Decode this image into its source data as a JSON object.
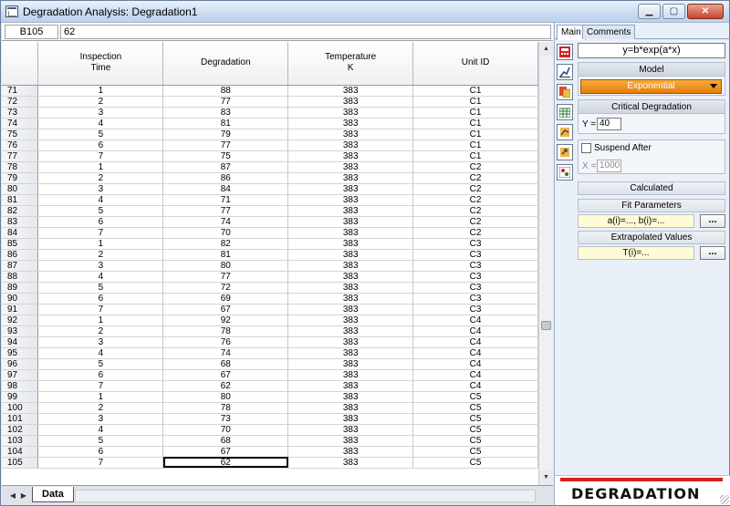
{
  "window": {
    "title": "Degradation Analysis: Degradation1"
  },
  "formula_bar": {
    "cell_ref": "B105",
    "cell_value": "62"
  },
  "grid": {
    "headers": [
      "",
      "Inspection\nTime",
      "Degradation",
      "Temperature\nK",
      "Unit ID"
    ],
    "rows": [
      [
        "71",
        "1",
        "88",
        "383",
        "C1"
      ],
      [
        "72",
        "2",
        "77",
        "383",
        "C1"
      ],
      [
        "73",
        "3",
        "83",
        "383",
        "C1"
      ],
      [
        "74",
        "4",
        "81",
        "383",
        "C1"
      ],
      [
        "75",
        "5",
        "79",
        "383",
        "C1"
      ],
      [
        "76",
        "6",
        "77",
        "383",
        "C1"
      ],
      [
        "77",
        "7",
        "75",
        "383",
        "C1"
      ],
      [
        "78",
        "1",
        "87",
        "383",
        "C2"
      ],
      [
        "79",
        "2",
        "86",
        "383",
        "C2"
      ],
      [
        "80",
        "3",
        "84",
        "383",
        "C2"
      ],
      [
        "81",
        "4",
        "71",
        "383",
        "C2"
      ],
      [
        "82",
        "5",
        "77",
        "383",
        "C2"
      ],
      [
        "83",
        "6",
        "74",
        "383",
        "C2"
      ],
      [
        "84",
        "7",
        "70",
        "383",
        "C2"
      ],
      [
        "85",
        "1",
        "82",
        "383",
        "C3"
      ],
      [
        "86",
        "2",
        "81",
        "383",
        "C3"
      ],
      [
        "87",
        "3",
        "80",
        "383",
        "C3"
      ],
      [
        "88",
        "4",
        "77",
        "383",
        "C3"
      ],
      [
        "89",
        "5",
        "72",
        "383",
        "C3"
      ],
      [
        "90",
        "6",
        "69",
        "383",
        "C3"
      ],
      [
        "91",
        "7",
        "67",
        "383",
        "C3"
      ],
      [
        "92",
        "1",
        "92",
        "383",
        "C4"
      ],
      [
        "93",
        "2",
        "78",
        "383",
        "C4"
      ],
      [
        "94",
        "3",
        "76",
        "383",
        "C4"
      ],
      [
        "95",
        "4",
        "74",
        "383",
        "C4"
      ],
      [
        "96",
        "5",
        "68",
        "383",
        "C4"
      ],
      [
        "97",
        "6",
        "67",
        "383",
        "C4"
      ],
      [
        "98",
        "7",
        "62",
        "383",
        "C4"
      ],
      [
        "99",
        "1",
        "80",
        "383",
        "C5"
      ],
      [
        "100",
        "2",
        "78",
        "383",
        "C5"
      ],
      [
        "101",
        "3",
        "73",
        "383",
        "C5"
      ],
      [
        "102",
        "4",
        "70",
        "383",
        "C5"
      ],
      [
        "103",
        "5",
        "68",
        "383",
        "C5"
      ],
      [
        "104",
        "6",
        "67",
        "383",
        "C5"
      ],
      [
        "105",
        "7",
        "62",
        "383",
        "C5"
      ]
    ],
    "selected_row_number": "105",
    "selected_column": 2
  },
  "sheet_tabs": {
    "active": "Data"
  },
  "panel": {
    "tabs": [
      "Main",
      "Comments"
    ],
    "equation": "y=b*exp(a*x)",
    "model": {
      "label": "Model",
      "value": "Exponential"
    },
    "critical": {
      "label": "Critical Degradation",
      "y_label": "Y =",
      "y_value": "40"
    },
    "suspend": {
      "label": "Suspend After",
      "x_label": "X =",
      "x_value": "1000"
    },
    "calculated_label": "Calculated",
    "fit": {
      "label": "Fit Parameters",
      "value": "a(i)=..., b(i)=...",
      "button": "..."
    },
    "extrapolated": {
      "label": "Extrapolated Values",
      "value": "T(i)=...",
      "button": "..."
    },
    "brand": "DEGRADATION",
    "accent_color": "#e57d08",
    "brand_color": "#d62020"
  },
  "icons": [
    "app-window-icon",
    "minimize-icon",
    "maximize-icon",
    "close-icon",
    "calculate-icon",
    "plot-icon",
    "report-icon",
    "table-icon",
    "transfer-icon",
    "export-icon",
    "settings-icon"
  ]
}
